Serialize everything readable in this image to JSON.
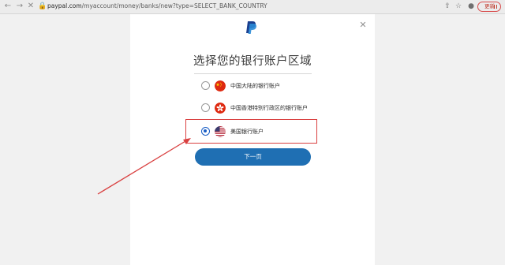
{
  "browser": {
    "url_host": "paypal.com",
    "url_path": "/myaccount/money/banks/new?type=SELECT_BANK_COUNTRY",
    "update_label": "更新"
  },
  "icons": {
    "back": "back-arrow-icon",
    "forward": "forward-arrow-icon",
    "reload": "close-icon",
    "home": "home-icon",
    "lock": "lock-icon",
    "share": "share-icon",
    "star": "star-icon",
    "profile": "profile-icon"
  },
  "dialog": {
    "title": "选择您的银行账户区域",
    "next_label": "下一页",
    "options": [
      {
        "label": "中国大陆的银行账户",
        "flag": "china-flag",
        "selected": false
      },
      {
        "label": "中国香港特别行政区的银行账户",
        "flag": "hong-kong-flag",
        "selected": false
      },
      {
        "label": "美国银行账户",
        "flag": "us-flag",
        "selected": true
      }
    ]
  },
  "colors": {
    "accent": "#1f6fb3",
    "highlight": "#d94040",
    "radio_selected": "#1a5ec5"
  }
}
